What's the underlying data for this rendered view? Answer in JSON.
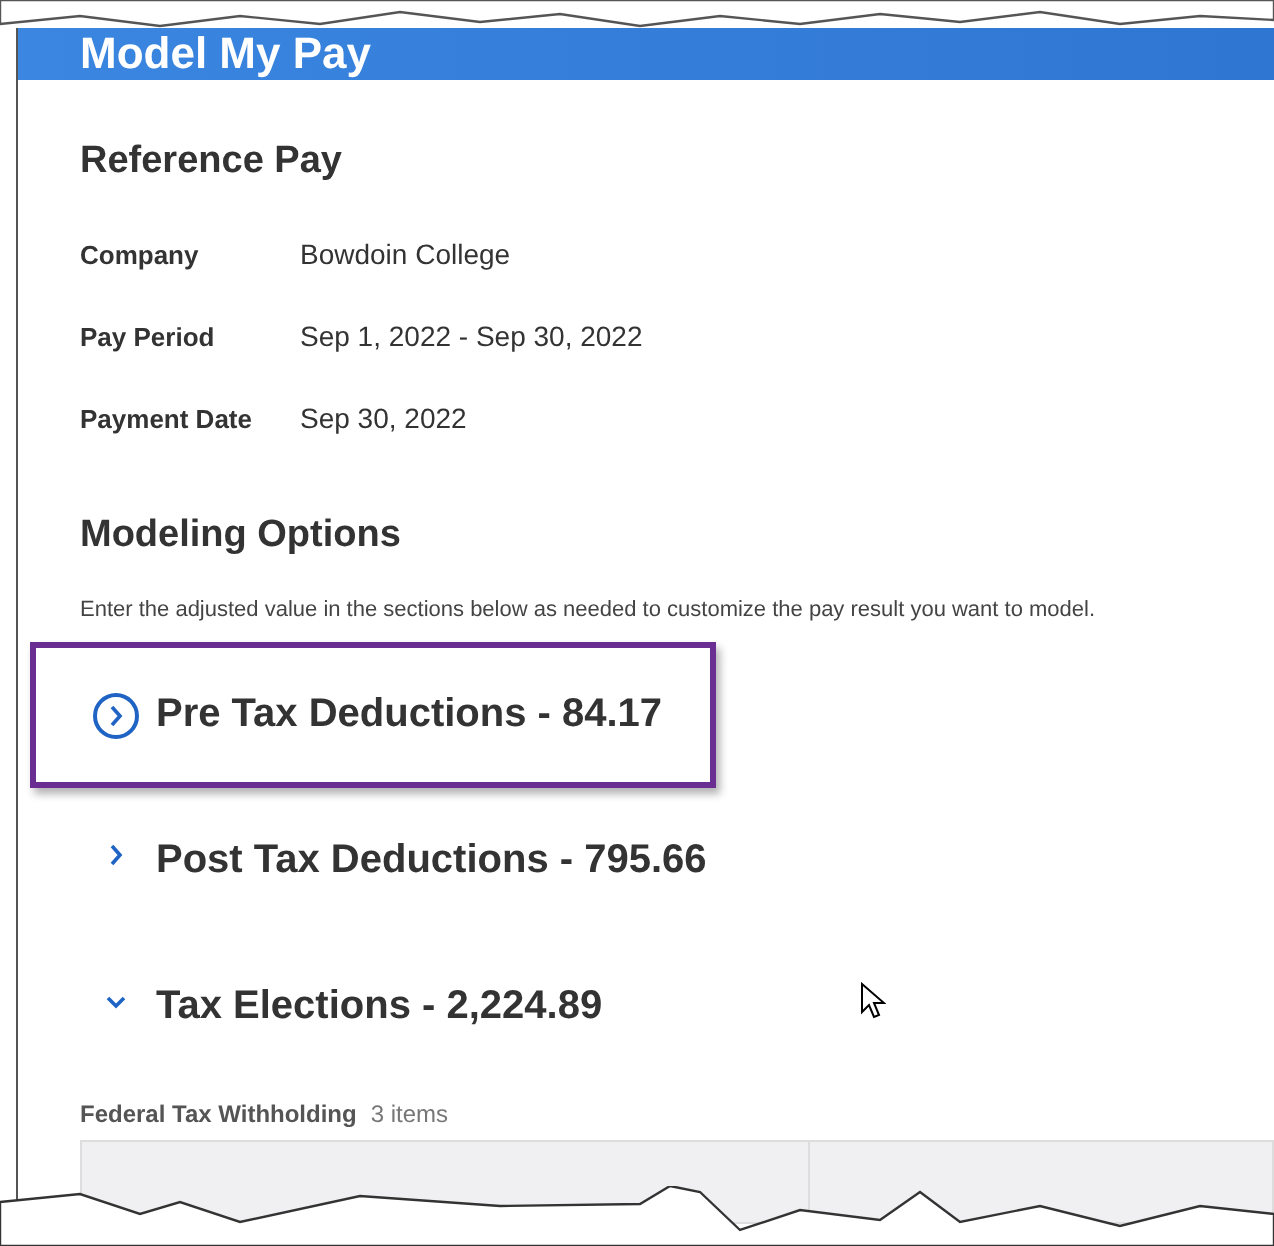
{
  "header": {
    "title": "Model My Pay"
  },
  "reference_pay": {
    "title": "Reference Pay",
    "fields": [
      {
        "label": "Company",
        "value": "Bowdoin College"
      },
      {
        "label": "Pay Period",
        "value": "Sep 1, 2022 - Sep 30, 2022"
      },
      {
        "label": "Payment Date",
        "value": "Sep 30, 2022"
      }
    ]
  },
  "modeling_options": {
    "title": "Modeling Options",
    "description": "Enter the adjusted value in the sections below as needed to customize the pay result you want to model.",
    "sections": [
      {
        "title": "Pre Tax Deductions - 84.17",
        "expanded": false,
        "highlighted": true
      },
      {
        "title": "Post Tax Deductions - 795.66",
        "expanded": false,
        "highlighted": false
      },
      {
        "title": "Tax Elections - 2,224.89",
        "expanded": true,
        "highlighted": false
      }
    ]
  },
  "federal_tax": {
    "title": "Federal Tax Withholding",
    "count": "3 items"
  }
}
